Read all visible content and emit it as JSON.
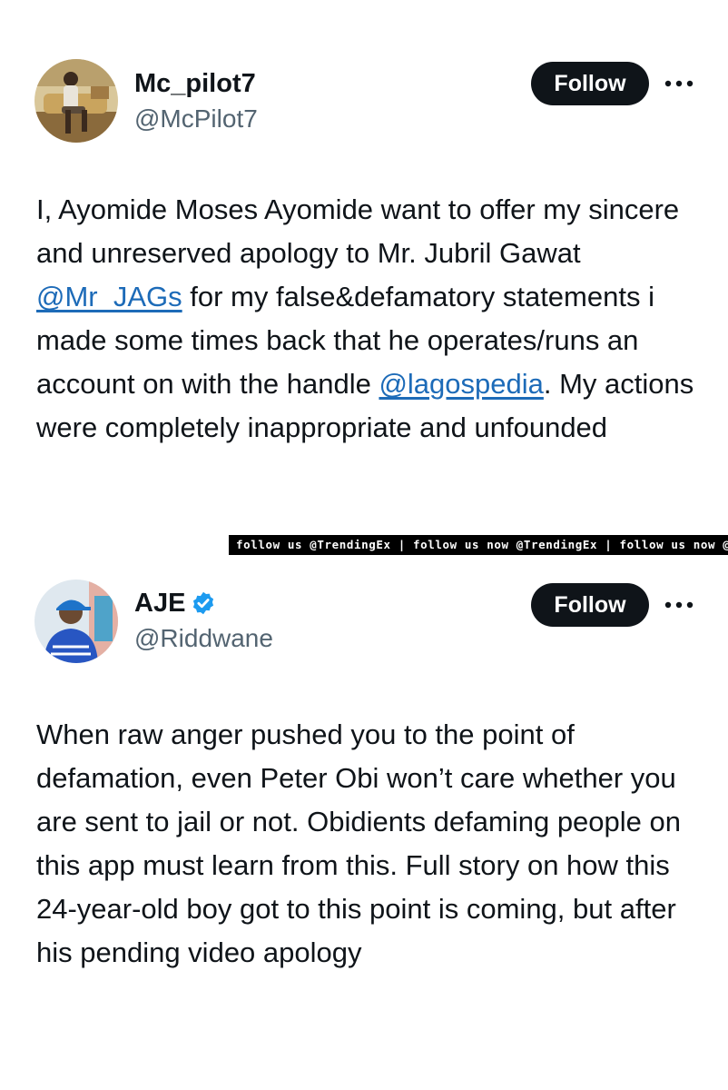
{
  "tweets": [
    {
      "display_name": "Mc_pilot7",
      "handle": "@McPilot7",
      "follow_label": "Follow",
      "more_icon": "more-horizontal-icon",
      "text_parts": {
        "p1": "I, Ayomide Moses Ayomide want to offer my sincere and unreserved apology to Mr. Jubril Gawat ",
        "mention1": "@Mr_JAGs",
        "p2": " for my false&defamatory statements i made some times back that he operates/runs an account on with the handle ",
        "mention2": "@lagospedia",
        "p3": ". My actions were completely inappropriate and unfounded"
      }
    },
    {
      "display_name": "AJE",
      "verified": true,
      "verified_color": "#1d9bf0",
      "handle": "@Riddwane",
      "follow_label": "Follow",
      "more_icon": "more-horizontal-icon",
      "text": "When raw anger pushed you to the point of defamation, even Peter Obi won’t care whether you are sent to jail or not. Obidients defaming people on this app must learn from this. Full story on how this 24-year-old boy got to this point is coming, but after his pending video apology"
    }
  ],
  "watermark_banner": "follow us @TrendingEx | follow us now @TrendingEx | follow us now @Trendi",
  "colors": {
    "text": "#0f1419",
    "secondary": "#536471",
    "button_bg": "#0f1419",
    "mention": "#1d6bb8",
    "background": "#ffffff"
  }
}
